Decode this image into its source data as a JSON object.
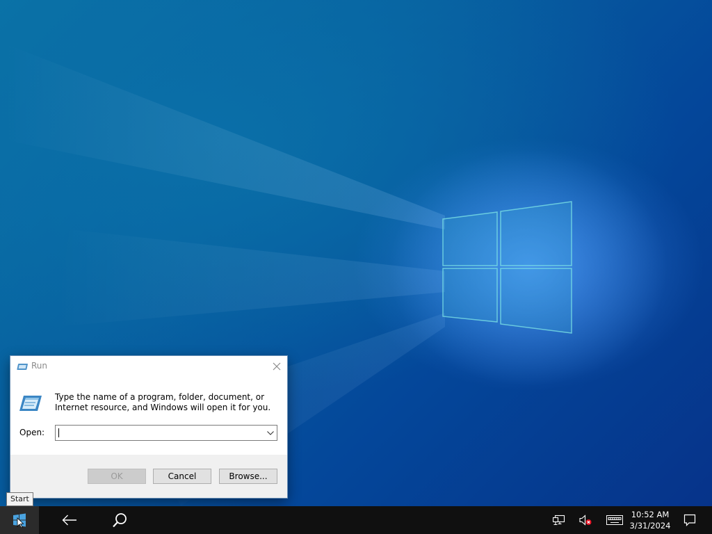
{
  "desktop": {
    "background_color": "#0760a0",
    "logo_glow_color": "#4696ff"
  },
  "run_dialog": {
    "title": "Run",
    "description": "Type the name of a program, folder, document, or Internet resource, and Windows will open it for you.",
    "open_label": "Open:",
    "open_value": "",
    "ok_label": "OK",
    "cancel_label": "Cancel",
    "browse_label": "Browse...",
    "ok_enabled": false
  },
  "tooltip": {
    "text": "Start"
  },
  "taskbar": {
    "background_color": "#101010",
    "buttons": [
      {
        "name": "start",
        "icon": "windows-icon"
      },
      {
        "name": "back",
        "icon": "arrow-left-icon"
      },
      {
        "name": "search",
        "icon": "search-icon"
      }
    ],
    "tray": {
      "network_icon": "network-icon",
      "volume_icon": "volume-muted-icon",
      "keyboard_icon": "keyboard-icon",
      "notification_icon": "notification-icon"
    },
    "clock": {
      "time": "10:52 AM",
      "date": "3/31/2024"
    }
  }
}
